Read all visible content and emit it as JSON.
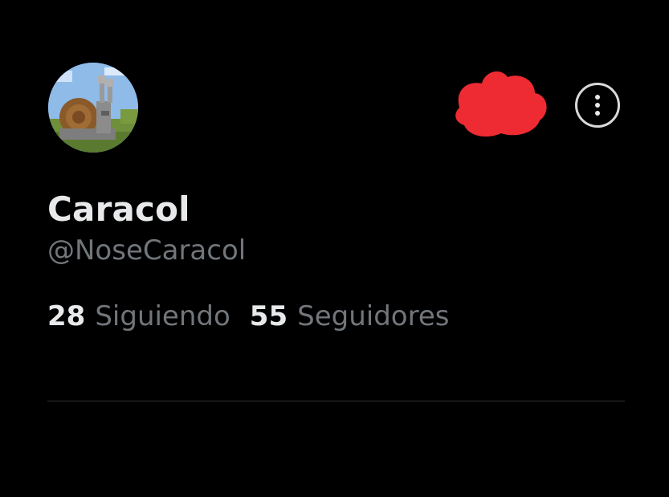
{
  "profile": {
    "display_name": "Caracol",
    "handle": "@NoseCaracol",
    "avatar_icon": "snail-avatar"
  },
  "stats": {
    "following_count": "28",
    "following_label": "Siguiendo",
    "followers_count": "55",
    "followers_label": "Seguidores"
  },
  "actions": {
    "more_icon": "more-options-icon"
  },
  "colors": {
    "background": "#000000",
    "primary_text": "#e7e9ea",
    "secondary_text": "#71767b",
    "divider": "#2f3336",
    "redaction": "#ee2b33"
  }
}
